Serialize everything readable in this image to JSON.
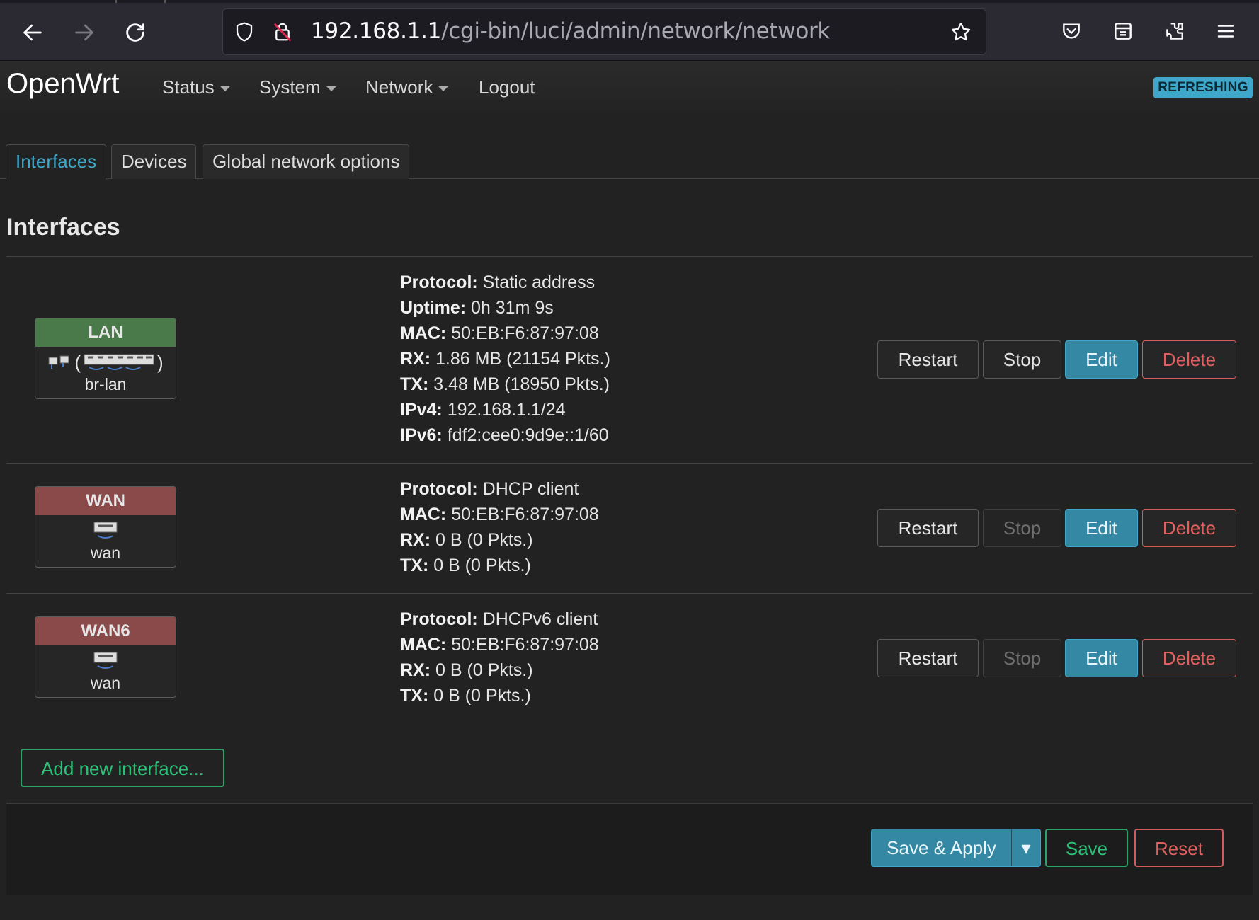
{
  "browser": {
    "url_host": "192.168.1.1",
    "url_path": "/cgi-bin/luci/admin/network/network",
    "icons": [
      "back-icon",
      "forward-icon",
      "reload-icon",
      "shield-icon",
      "insecure-lock-icon",
      "star-icon",
      "pocket-icon",
      "container-icon",
      "extensions-icon",
      "menu-icon"
    ]
  },
  "header": {
    "brand": "OpenWrt",
    "menu": [
      {
        "label": "Status",
        "dropdown": true
      },
      {
        "label": "System",
        "dropdown": true
      },
      {
        "label": "Network",
        "dropdown": true
      },
      {
        "label": "Logout",
        "dropdown": false
      }
    ],
    "indicator": "REFRESHING"
  },
  "tabs": [
    {
      "label": "Interfaces",
      "active": true
    },
    {
      "label": "Devices",
      "active": false
    },
    {
      "label": "Global network options",
      "active": false
    }
  ],
  "section_title": "Interfaces",
  "interfaces": [
    {
      "name": "LAN",
      "device_glyph": "(",
      "device_glyph_close": ")",
      "device": "br-lan",
      "color": "#4a7a4a",
      "details": [
        {
          "key": "Protocol:",
          "value": "Static address"
        },
        {
          "key": "Uptime:",
          "value": "0h 31m 9s"
        },
        {
          "key": "MAC:",
          "value": "50:EB:F6:87:97:08"
        },
        {
          "key": "RX:",
          "value": "1.86 MB (21154 Pkts.)"
        },
        {
          "key": "TX:",
          "value": "3.48 MB (18950 Pkts.)"
        },
        {
          "key": "IPv4:",
          "value": "192.168.1.1/24"
        },
        {
          "key": "IPv6:",
          "value": "fdf2:cee0:9d9e::1/60"
        }
      ],
      "stop_enabled": true
    },
    {
      "name": "WAN",
      "device": "wan",
      "color": "#8a4a4a",
      "details": [
        {
          "key": "Protocol:",
          "value": "DHCP client"
        },
        {
          "key": "MAC:",
          "value": "50:EB:F6:87:97:08"
        },
        {
          "key": "RX:",
          "value": "0 B (0 Pkts.)"
        },
        {
          "key": "TX:",
          "value": "0 B (0 Pkts.)"
        }
      ],
      "stop_enabled": false
    },
    {
      "name": "WAN6",
      "device": "wan",
      "color": "#8a4a4a",
      "details": [
        {
          "key": "Protocol:",
          "value": "DHCPv6 client"
        },
        {
          "key": "MAC:",
          "value": "50:EB:F6:87:97:08"
        },
        {
          "key": "RX:",
          "value": "0 B (0 Pkts.)"
        },
        {
          "key": "TX:",
          "value": "0 B (0 Pkts.)"
        }
      ],
      "stop_enabled": false
    }
  ],
  "row_buttons": {
    "restart": "Restart",
    "stop": "Stop",
    "edit": "Edit",
    "delete": "Delete"
  },
  "add_interface": "Add new interface...",
  "footer": {
    "save_apply": "Save & Apply",
    "dropdown_arrow": "▾",
    "save": "Save",
    "reset": "Reset"
  }
}
